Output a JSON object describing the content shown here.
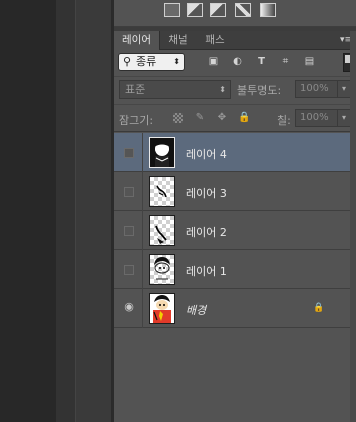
{
  "layers_panel": {
    "tabs": [
      {
        "label": "레이어",
        "active": true
      },
      {
        "label": "채널",
        "active": false
      },
      {
        "label": "패스",
        "active": false
      }
    ],
    "filter": {
      "kind_label": "종류"
    },
    "blend_mode": {
      "value": "표준"
    },
    "opacity": {
      "label": "불투명도:",
      "value": "100%"
    },
    "lock": {
      "label": "잠그기:"
    },
    "fill": {
      "label": "칠:",
      "value": "100%"
    },
    "layers": [
      {
        "name": "레이어 4",
        "visible": false,
        "selected": true,
        "locked": false,
        "italic": false
      },
      {
        "name": "레이어 3",
        "visible": false,
        "selected": false,
        "locked": false,
        "italic": false
      },
      {
        "name": "레이어 2",
        "visible": false,
        "selected": false,
        "locked": false,
        "italic": false
      },
      {
        "name": "레이어 1",
        "visible": false,
        "selected": false,
        "locked": false,
        "italic": false
      },
      {
        "name": "배경",
        "visible": true,
        "selected": false,
        "locked": true,
        "italic": true
      }
    ]
  },
  "colors": {
    "panel": "#535353",
    "tab_bar": "#3e3e3e",
    "selected_row": "#5c6a7d",
    "canvas_dark": "#282828"
  }
}
